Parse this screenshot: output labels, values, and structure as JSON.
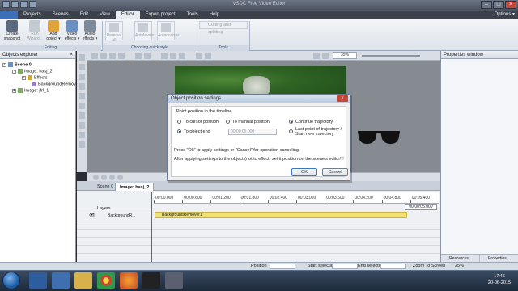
{
  "window": {
    "title": "VSDC Free Video Editor"
  },
  "menu": {
    "tabs": [
      "Projects",
      "Scenes",
      "Edit",
      "View",
      "Editor",
      "Export project",
      "Tools",
      "Help"
    ],
    "active": "Editor",
    "options": "Options ▾"
  },
  "ribbon": {
    "create_snapshot": "Create snapshot",
    "run_wizard": "Run Wizard...",
    "add_object": "Add object ▾",
    "video_effects": "Video effects ▾",
    "audio_effects": "Audio effects ▾",
    "remove_all": "Remove all",
    "autolevels": "Autolevels",
    "autocontrast": "Autocontrast",
    "cutting_splitting": "Cutting and splitting",
    "group_editing": "Editing",
    "group_quick_style": "Choosing quick style",
    "group_tools": "Tools"
  },
  "explorer": {
    "title": "Objects explorer",
    "items": [
      "Scene 0",
      "Image: hasj_2",
      "Effects",
      "BackgroundRemover",
      "Image: jfrl_1"
    ]
  },
  "canvas": {
    "zoom": "35%"
  },
  "properties": {
    "title": "Properties window",
    "tab_resources": "Resources ...",
    "tab_properties": "Properties ..."
  },
  "timeline": {
    "tab_scene": "Scene 0",
    "tab_image": "Image: hasj_2",
    "layers_label": "Layers",
    "track_name": "BackgroundR...",
    "clip_label": "BackgroundRemover1",
    "ticks": [
      "00:00.000",
      "00:00.600",
      "00:01.200",
      "00:01.800",
      "00:02.400",
      "00:03.000",
      "00:03.600",
      "00:04.200",
      "00:04.800",
      "00:05.400"
    ],
    "current_time": "00:00:05.000"
  },
  "dialog": {
    "title": "Object position settings",
    "group_label": "Point position in the timeline",
    "opt_cursor": "To cursor position",
    "opt_manual": "To manual position",
    "opt_object_end": "To object end",
    "time_value": "00:00:05.000",
    "opt_continue": "Continue trajectory",
    "opt_last_point": "Last point of trajectory / Start new trajectory",
    "info1": "Press \"Ok\" to apply settings or \"Cancel\" for operation canceling.",
    "info2": "After applying settings to the object (not to effect) set it position on the scene's editor!!!",
    "ok": "OK",
    "cancel": "Cancel"
  },
  "statusbar": {
    "position_label": "Position",
    "start_label": "Start selection",
    "end_label": "End selection",
    "zoom_label": "Zoom To Screen",
    "zoom_value": "35%"
  },
  "taskbar": {
    "time": "17:46",
    "date": "20-06-2015"
  }
}
